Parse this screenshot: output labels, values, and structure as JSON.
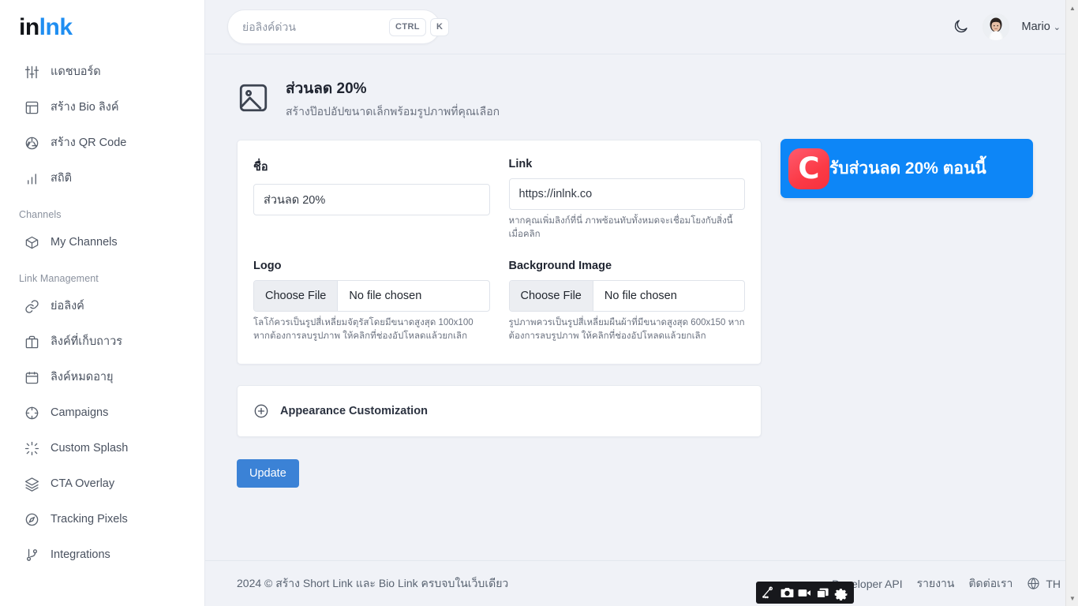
{
  "brand": {
    "part1": "in",
    "part2": "lnk"
  },
  "sidebar": {
    "items": [
      {
        "icon": "sliders-icon",
        "label": "แดชบอร์ด"
      },
      {
        "icon": "layout-icon",
        "label": "สร้าง Bio ลิงค์"
      },
      {
        "icon": "aperture-icon",
        "label": "สร้าง QR Code"
      },
      {
        "icon": "bar-chart-icon",
        "label": "สถิติ"
      }
    ],
    "sections": [
      {
        "title": "Channels",
        "items": [
          {
            "icon": "package-icon",
            "label": "My Channels"
          }
        ]
      },
      {
        "title": "Link Management",
        "items": [
          {
            "icon": "link-icon",
            "label": "ย่อลิงค์"
          },
          {
            "icon": "archive-icon",
            "label": "ลิงค์ที่เก็บถาวร"
          },
          {
            "icon": "calendar-icon",
            "label": "ลิงค์หมดอายุ"
          },
          {
            "icon": "target-icon",
            "label": "Campaigns"
          },
          {
            "icon": "sparkle-icon",
            "label": "Custom Splash"
          },
          {
            "icon": "layers-icon",
            "label": "CTA Overlay"
          },
          {
            "icon": "compass-icon",
            "label": "Tracking Pixels"
          },
          {
            "icon": "git-branch-icon",
            "label": "Integrations"
          }
        ]
      }
    ]
  },
  "topbar": {
    "search_placeholder": "ย่อลิงค์ด่วน",
    "search_value": "",
    "kbd_ctrl": "CTRL",
    "kbd_key": "K",
    "user_name": "Mario",
    "caret": "⌄"
  },
  "page": {
    "title": "ส่วนลด 20%",
    "subtitle": "สร้างป๊อปอัปขนาดเล็กพร้อมรูปภาพที่คุณเลือก"
  },
  "form": {
    "name_label": "ชื่อ",
    "name_value": "ส่วนลด 20%",
    "link_label": "Link",
    "link_value": "https://inlnk.co",
    "link_helper": "หากคุณเพิ่มลิงก์ที่นี่ ภาพซ้อนทับทั้งหมดจะเชื่อมโยงกับสิ่งนี้เมื่อคลิก",
    "logo_label": "Logo",
    "logo_button": "Choose File",
    "logo_filename": "No file chosen",
    "logo_helper": "โลโก้ควรเป็นรูปสี่เหลี่ยมจัตุรัสโดยมีขนาดสูงสุด 100x100 หากต้องการลบรูปภาพ ให้คลิกที่ช่องอัปโหลดแล้วยกเลิก",
    "bg_label": "Background Image",
    "bg_button": "Choose File",
    "bg_filename": "No file chosen",
    "bg_helper": "รูปภาพควรเป็นรูปสี่เหลี่ยมผืนผ้าที่มีขนาดสูงสุด 600x150 หากต้องการลบรูปภาพ ให้คลิกที่ช่องอัปโหลดแล้วยกเลิก",
    "accordion_title": "Appearance Customization",
    "update_button": "Update"
  },
  "preview": {
    "logo_letter": "C",
    "text": "รับส่วนลด 20% ตอนนี้",
    "bg_color": "#0d86f7",
    "logo_color": "#fb3a46"
  },
  "footer": {
    "copyright": "2024 © สร้าง Short Link และ Bio Link ครบจบในเว็บเดียว",
    "links": [
      {
        "label": "Developer API"
      },
      {
        "label": "รายงาน"
      },
      {
        "label": "ติดต่อเรา"
      }
    ],
    "language": "TH"
  },
  "recorder": {
    "icons": [
      "screenshot-region-icon",
      "camera-icon",
      "video-camera-icon",
      "window-icon",
      "gear-icon"
    ]
  }
}
